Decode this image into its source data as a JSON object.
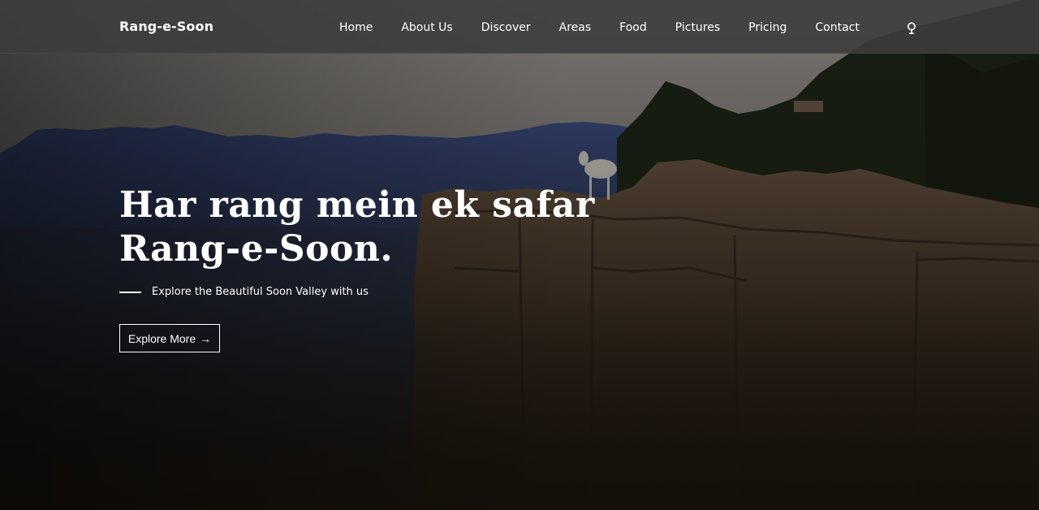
{
  "navbar": {
    "brand": "Rang-e-Soon",
    "links": [
      {
        "label": "Home"
      },
      {
        "label": "About Us"
      },
      {
        "label": "Discover"
      },
      {
        "label": "Areas"
      },
      {
        "label": "Food"
      },
      {
        "label": "Pictures"
      },
      {
        "label": "Pricing"
      },
      {
        "label": "Contact"
      }
    ],
    "search_icon": "search-icon"
  },
  "hero": {
    "title_line1": "Har rang mein ek safar",
    "title_line2": "Rang-e-Soon.",
    "subtitle": "Explore the Beautiful Soon Valley with us",
    "cta_label": "Explore More",
    "cta_arrow": "→"
  },
  "colors": {
    "navbar_bg": "#3c3c3c",
    "text": "#ffffff",
    "sky": "#9a9690",
    "mountains": "#3a4a7a",
    "cliff": "#5a4636",
    "overlay_dark": "#15110c"
  }
}
